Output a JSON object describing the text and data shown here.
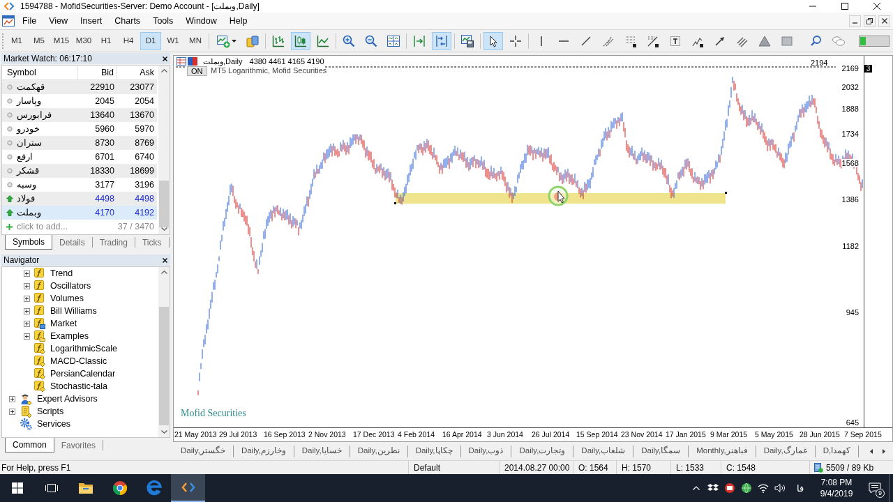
{
  "window": {
    "title": "1594788 - MofidSecurities-Server: Demo Account - [وبملت,Daily]"
  },
  "menu": [
    "File",
    "View",
    "Insert",
    "Charts",
    "Tools",
    "Window",
    "Help"
  ],
  "timeframes": [
    {
      "label": "M1",
      "selected": false
    },
    {
      "label": "M5",
      "selected": false
    },
    {
      "label": "M15",
      "selected": false
    },
    {
      "label": "M30",
      "selected": false
    },
    {
      "label": "H1",
      "selected": false
    },
    {
      "label": "H4",
      "selected": false
    },
    {
      "label": "D1",
      "selected": true
    },
    {
      "label": "W1",
      "selected": false
    },
    {
      "label": "MN",
      "selected": false
    }
  ],
  "tool_groups": [
    [
      {
        "kind": "newchart",
        "on": false
      },
      {
        "kind": "money",
        "on": false
      }
    ],
    [
      {
        "kind": "bars",
        "on": false
      },
      {
        "kind": "candles",
        "on": true
      },
      {
        "kind": "line",
        "on": false
      }
    ],
    [
      {
        "kind": "zoomin",
        "on": false
      },
      {
        "kind": "zoomout",
        "on": false
      },
      {
        "kind": "tile",
        "on": false
      }
    ],
    [
      {
        "kind": "shift",
        "on": false
      },
      {
        "kind": "autoscroll",
        "on": true
      }
    ],
    [
      {
        "kind": "templates",
        "on": false
      }
    ],
    [
      {
        "kind": "cursor",
        "on": true
      },
      {
        "kind": "crosshair",
        "on": false
      }
    ],
    [
      {
        "kind": "vline",
        "on": false
      },
      {
        "kind": "hline",
        "on": false
      },
      {
        "kind": "trend",
        "on": false
      },
      {
        "kind": "channel",
        "on": false
      },
      {
        "kind": "fibo",
        "on": false
      },
      {
        "kind": "fan",
        "on": false
      },
      {
        "kind": "text",
        "on": false
      },
      {
        "kind": "elliott",
        "on": false
      },
      {
        "kind": "arrow",
        "on": false
      },
      {
        "kind": "pitchfork",
        "on": false
      },
      {
        "kind": "triangle",
        "on": false
      },
      {
        "kind": "rectangle",
        "on": false
      }
    ],
    [
      {
        "kind": "search",
        "on": false
      },
      {
        "kind": "chat",
        "on": false
      }
    ]
  ],
  "market_watch": {
    "title": "Market Watch: 06:17:10",
    "columns": [
      "Symbol",
      "Bid",
      "Ask"
    ],
    "rows": [
      {
        "symbol": "قهکمت",
        "bid": "22910",
        "ask": "23077",
        "kind": "idle",
        "selected": false
      },
      {
        "symbol": "وپاسار",
        "bid": "2045",
        "ask": "2054",
        "kind": "idle",
        "selected": false
      },
      {
        "symbol": "فرابورس",
        "bid": "13640",
        "ask": "13670",
        "kind": "idle",
        "selected": false
      },
      {
        "symbol": "خودرو",
        "bid": "5960",
        "ask": "5970",
        "kind": "idle",
        "selected": false
      },
      {
        "symbol": "ستران",
        "bid": "8730",
        "ask": "8769",
        "kind": "idle",
        "selected": false
      },
      {
        "symbol": "ارفع",
        "bid": "6701",
        "ask": "6740",
        "kind": "idle",
        "selected": false
      },
      {
        "symbol": "قشکر",
        "bid": "18330",
        "ask": "18699",
        "kind": "idle",
        "selected": false
      },
      {
        "symbol": "وسبه",
        "bid": "3177",
        "ask": "3196",
        "kind": "idle",
        "selected": false
      },
      {
        "symbol": "فولاد",
        "bid": "4498",
        "ask": "4498",
        "kind": "up",
        "selected": false
      },
      {
        "symbol": "وبملت",
        "bid": "4170",
        "ask": "4192",
        "kind": "up",
        "selected": true
      }
    ],
    "add_hint": "click to add...",
    "count": "37 / 3470",
    "tabs": [
      {
        "label": "Symbols",
        "selected": true
      },
      {
        "label": "Details",
        "selected": false
      },
      {
        "label": "Trading",
        "selected": false
      },
      {
        "label": "Ticks",
        "selected": false
      }
    ]
  },
  "navigator": {
    "title": "Navigator",
    "tree": [
      {
        "children": [
          {
            "label": "Trend",
            "kind": "group",
            "expanded": false
          },
          {
            "label": "Oscillators",
            "kind": "group",
            "expanded": false
          },
          {
            "label": "Volumes",
            "kind": "group",
            "expanded": false
          },
          {
            "label": "Bill Williams",
            "kind": "group",
            "expanded": false
          },
          {
            "label": "Market",
            "kind": "market",
            "expanded": false
          },
          {
            "label": "Examples",
            "kind": "examples",
            "expanded": false
          },
          {
            "label": "LogarithmicScale",
            "kind": "indicator"
          },
          {
            "label": "MACD-Classic",
            "kind": "indicator"
          },
          {
            "label": "PersianCalendar",
            "kind": "indicator"
          },
          {
            "label": "Stochastic-tala",
            "kind": "indicator"
          }
        ]
      },
      {
        "label": "Expert Advisors",
        "kind": "experts",
        "expanded": false
      },
      {
        "label": "Scripts",
        "kind": "scripts",
        "expanded": false
      },
      {
        "label": "Services",
        "kind": "services"
      }
    ],
    "tabs": [
      {
        "label": "Common",
        "selected": true
      },
      {
        "label": "Favorites",
        "selected": false
      }
    ]
  },
  "chart": {
    "symbol": "وبملت,Daily",
    "ohlc": "4380 4461 4165 4190",
    "on_button": "ON",
    "indicator": "MT5 Logarithmic, Mofid Securities",
    "line_label": "2194",
    "level_marker": "3",
    "price_labels": [
      "2169",
      "2032",
      "1888",
      "1734",
      "1568",
      "1386",
      "1182",
      "945",
      "645"
    ],
    "time_labels": [
      "21 May 2013",
      "29 Jul 2013",
      "16 Sep 2013",
      "2 Nov 2013",
      "17 Dec 2013",
      "4 Feb 2014",
      "16 Apr 2014",
      "3 Jun 2014",
      "26 Jul 2014",
      "15 Sep 2014",
      "23 Nov 2014",
      "17 Jan 2015",
      "9 Mar 2015",
      "5 May 2015",
      "28 Jun 2015",
      "7 Sep 2015"
    ],
    "brand": "Mofid Securities"
  },
  "chart_tabs": [
    {
      "label": "Daily,خگستر",
      "selected": false
    },
    {
      "label": "Daily,وخارزم",
      "selected": false
    },
    {
      "label": "Daily,خسایا",
      "selected": false
    },
    {
      "label": "Daily,نطرین",
      "selected": false
    },
    {
      "label": "Daily,چکاپا",
      "selected": false
    },
    {
      "label": "Daily,ذوب",
      "selected": false
    },
    {
      "label": "Daily,وتجارت",
      "selected": false
    },
    {
      "label": "Daily,شلعاب",
      "selected": false
    },
    {
      "label": "Daily,سمگا",
      "selected": false
    },
    {
      "label": "Monthly,فباهنر",
      "selected": false
    },
    {
      "label": "Daily,غمارگ",
      "selected": false
    },
    {
      "label": "D,کهمدا",
      "selected": false
    }
  ],
  "status_bar": {
    "help": "For Help, press F1",
    "profile": "Default",
    "time": "2014.08.27 00:00",
    "open": "O: 1564",
    "high": "H: 1570",
    "low": "L: 1533",
    "close": "C: 1548",
    "traffic": "5509 / 89 Kb"
  },
  "taskbar": {
    "apps": [
      {
        "kind": "start",
        "active": false
      },
      {
        "kind": "taskview",
        "active": false
      },
      {
        "kind": "explorer",
        "active": false
      },
      {
        "kind": "chrome",
        "active": false
      },
      {
        "kind": "edge",
        "active": false
      },
      {
        "kind": "metatrader",
        "active": true
      }
    ],
    "language": "فا",
    "time": "7:08 PM",
    "date": "9/4/2019",
    "notifications": "9"
  }
}
